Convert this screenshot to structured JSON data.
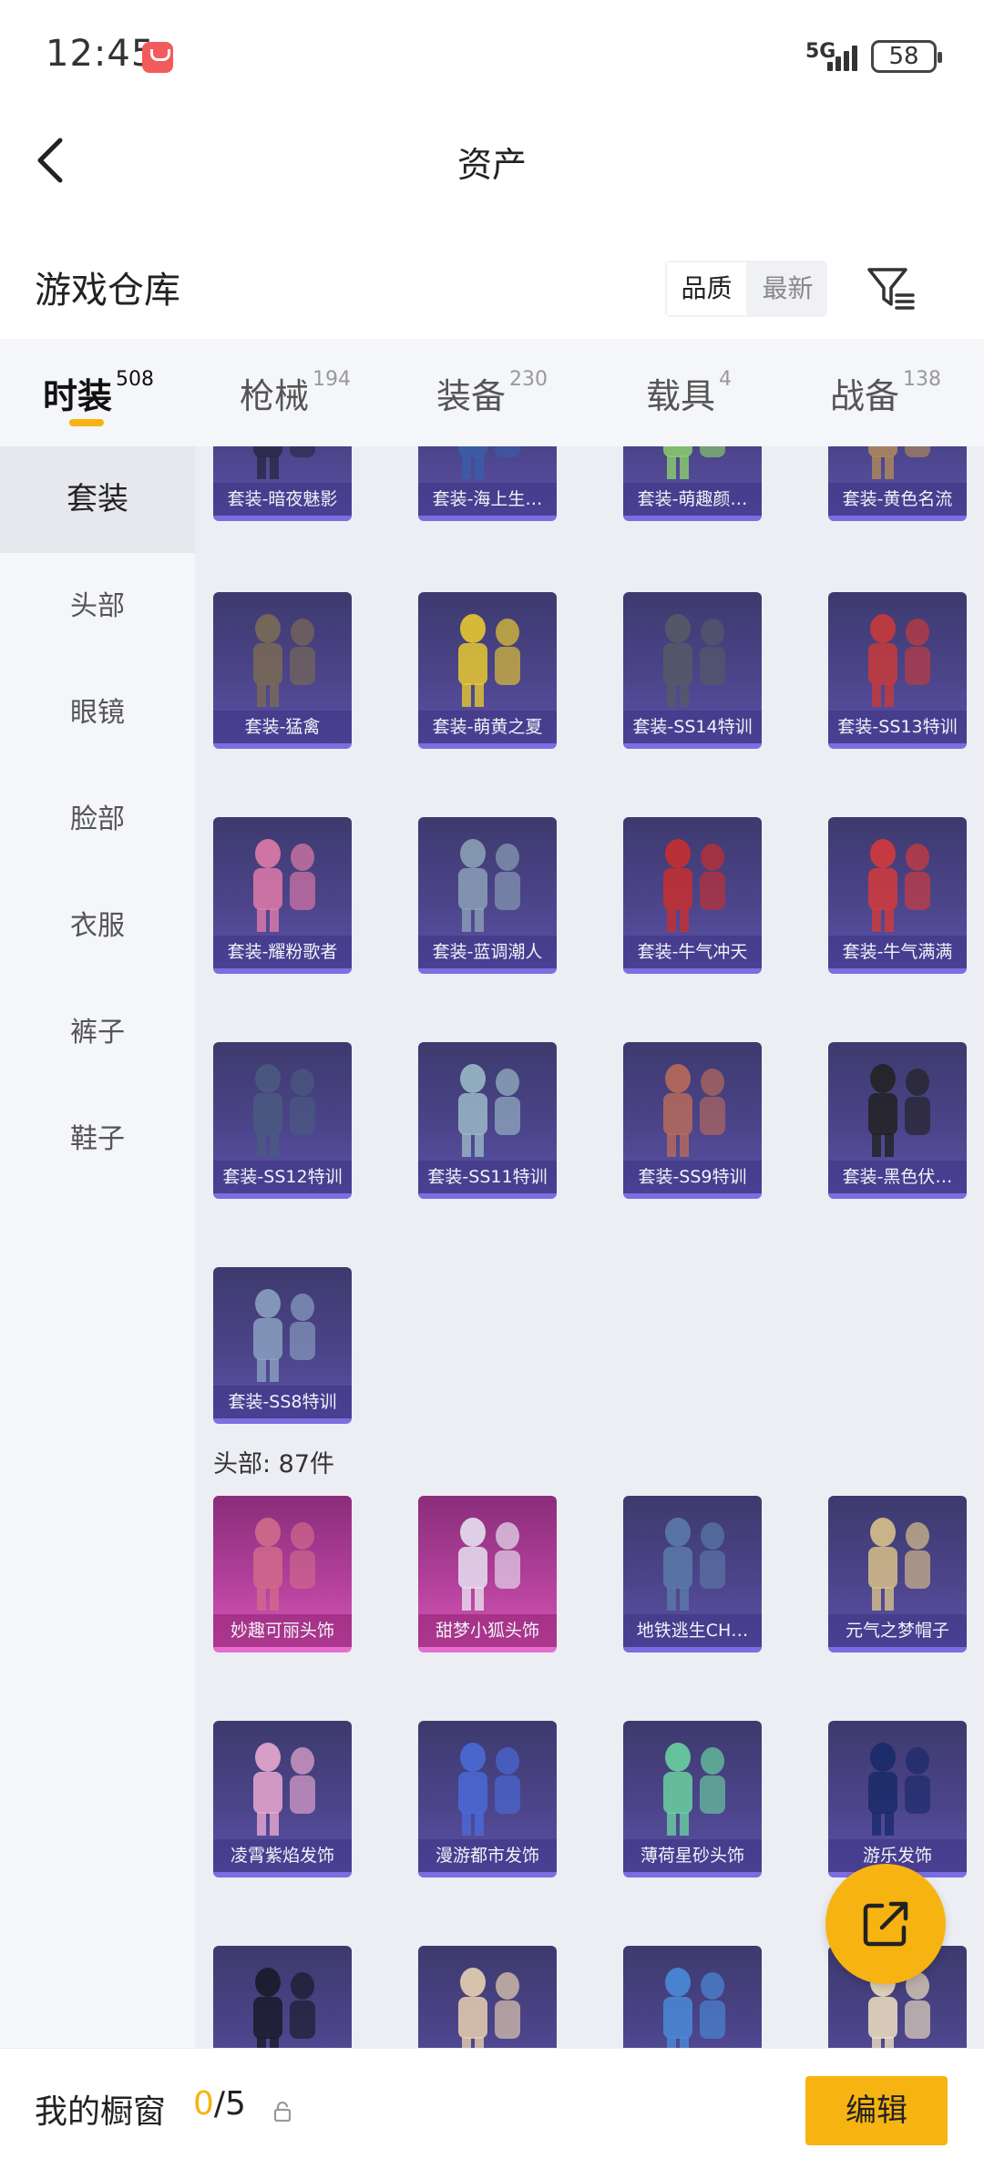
{
  "status_bar": {
    "time": "12:45",
    "network": "5G",
    "battery": "58"
  },
  "header": {
    "title": "资产"
  },
  "section": {
    "title": "游戏仓库",
    "sort_options": [
      "品质",
      "最新"
    ],
    "sort_active": "品质"
  },
  "tabs": [
    {
      "label": "时装",
      "count": "508"
    },
    {
      "label": "枪械",
      "count": "194"
    },
    {
      "label": "装备",
      "count": "230"
    },
    {
      "label": "载具",
      "count": "4"
    },
    {
      "label": "战备",
      "count": "138"
    }
  ],
  "sidebar": {
    "items": [
      "套装",
      "头部",
      "眼镜",
      "脸部",
      "衣服",
      "裤子",
      "鞋子"
    ]
  },
  "grid": {
    "outfits": [
      "套装-暗夜魅影",
      "套装-海上生…",
      "套装-萌趣颜…",
      "套装-黄色名流",
      "套装-猛禽",
      "套装-萌黄之夏",
      "套装-SS14特训",
      "套装-SS13特训",
      "套装-耀粉歌者",
      "套装-蓝调潮人",
      "套装-牛气冲天",
      "套装-牛气满满",
      "套装-SS12特训",
      "套装-SS11特训",
      "套装-SS9特训",
      "套装-黑色伏…",
      "套装-SS8特训"
    ],
    "head_group_label": "头部: 87件",
    "head_items": [
      "妙趣可丽头饰",
      "甜梦小狐头饰",
      "地铁逃生CH…",
      "元气之梦帽子",
      "凌霄紫焰发饰",
      "漫游都市发饰",
      "薄荷星砂头饰",
      "游乐发饰",
      "",
      "",
      "",
      ""
    ]
  },
  "bottom_bar": {
    "showcase_label": "我的橱窗",
    "showcase_current": "0",
    "showcase_total": "/5",
    "edit_label": "编辑"
  },
  "colors": {
    "accent": "#f6b312",
    "item_bg": "#4b4489",
    "item_pink": "#b13f9a"
  }
}
